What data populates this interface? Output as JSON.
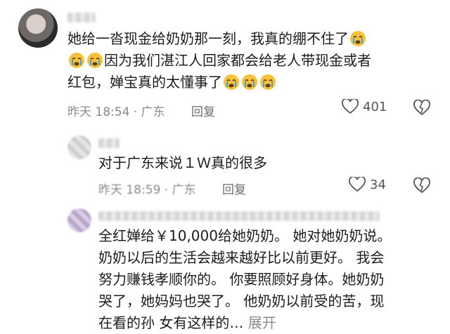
{
  "comments": [
    {
      "text_1": "她给一沓现金给奶奶那一刻，我真的绷不住了",
      "text_2": "因为我们湛江人回家都会给老人带现金或者",
      "text_3": "红包，婵宝真的太懂事了",
      "time": "昨天 18:54 · 广东",
      "reply_label": "回复",
      "likes": "401"
    },
    {
      "text_1": "对于广东来说１Ｗ真的很多",
      "time": "昨天 18:59 · 广东",
      "reply_label": "回复",
      "likes": "34"
    },
    {
      "text_1": "全红婵给￥10,000给她奶奶。 她对她奶奶说。",
      "text_2": "奶奶以后的生活会越来越好比以前更好。 我会",
      "text_3": "努力赚钱孝顺你的。 你要照顾好身体。她奶奶",
      "text_4": "哭了，她妈妈也哭了。 他奶奶以前受的苦，现",
      "text_5": "在看的孙 女有这样的…",
      "expand_label": "展开"
    }
  ],
  "icons": [
    "crying-emoji-icon",
    "heart-icon",
    "dislike-icon"
  ],
  "colors": {
    "text": "#1c1c1c",
    "meta": "#8a8a8a",
    "emoji": "#f7c23a",
    "tear": "#3aa0e8"
  }
}
